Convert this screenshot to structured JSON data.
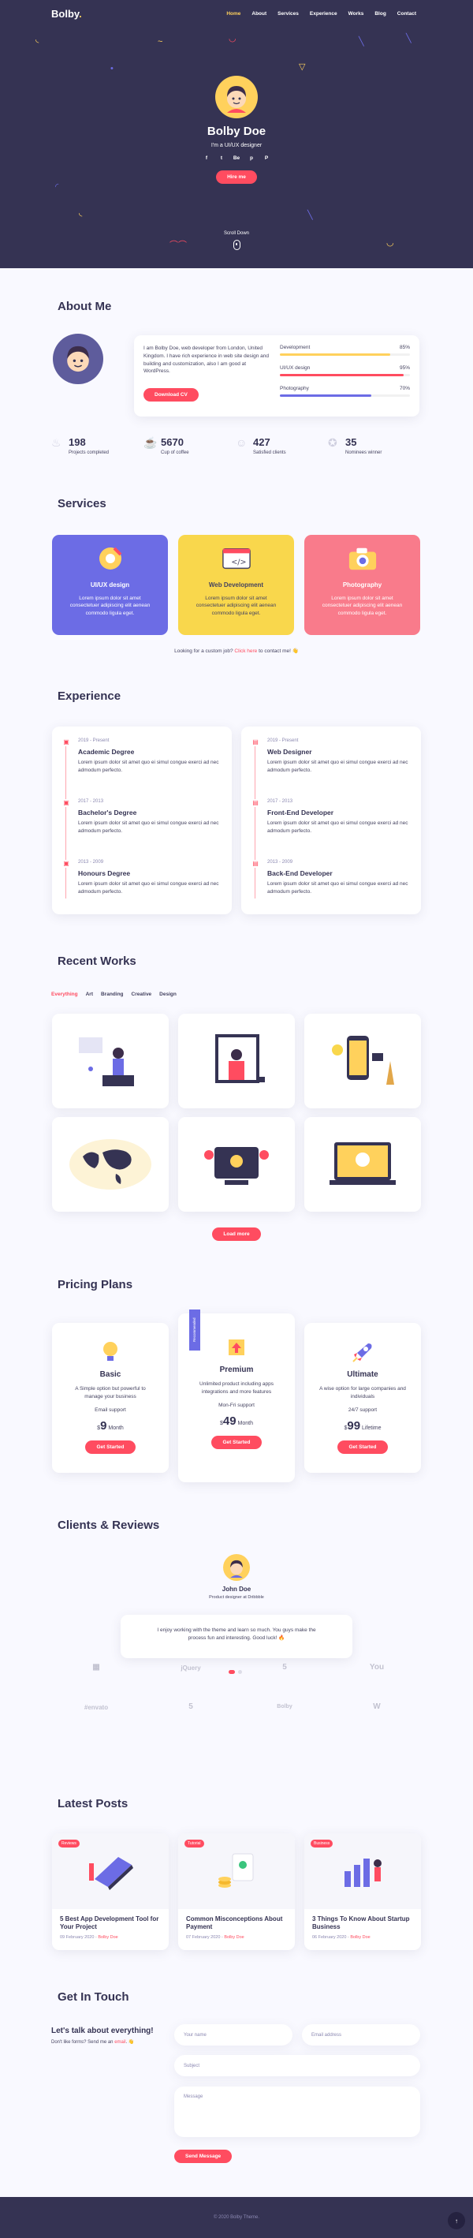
{
  "nav": {
    "logo": "Bolby",
    "logo_dot": ".",
    "items": [
      "Home",
      "About",
      "Services",
      "Experience",
      "Works",
      "Blog",
      "Contact"
    ]
  },
  "hero": {
    "name": "Bolby Doe",
    "subtitle": "I'm a UI/UX designer",
    "socials": [
      "f",
      "t",
      "Be",
      "p",
      "P"
    ],
    "button": "Hire me",
    "scroll": "Scroll Down"
  },
  "about": {
    "title": "About Me",
    "text": "I am Bolby Doe, web developer from London, United Kingdom. I have rich experience in web site design and building and customization, also I am good at WordPress.",
    "button": "Download CV",
    "skills": [
      {
        "name": "Development",
        "value": "85%",
        "level": 85,
        "color": "#ffd15c"
      },
      {
        "name": "UI/UX design",
        "value": "95%",
        "level": 95,
        "color": "#ff4c60"
      },
      {
        "name": "Photography",
        "value": "70%",
        "level": 70,
        "color": "#6c6ce5"
      }
    ],
    "facts": [
      {
        "num": "198",
        "label": "Projects completed"
      },
      {
        "num": "5670",
        "label": "Cup of coffee"
      },
      {
        "num": "427",
        "label": "Satisfied clients"
      },
      {
        "num": "35",
        "label": "Nominees winner"
      }
    ]
  },
  "services": {
    "title": "Services",
    "items": [
      {
        "title": "UI/UX design",
        "text": "Lorem ipsum dolor sit amet consectetuer adipiscing elit aenean commodo ligula eget.",
        "bg": "#6c6ce5",
        "color": "#ffffff"
      },
      {
        "title": "Web Development",
        "text": "Lorem ipsum dolor sit amet consectetuer adipiscing elit aenean commodo ligula eget.",
        "bg": "#f9d74c",
        "color": "#454360"
      },
      {
        "title": "Photography",
        "text": "Lorem ipsum dolor sit amet consectetuer adipiscing elit aenean commodo ligula eget.",
        "bg": "#f97b8b",
        "color": "#ffffff"
      }
    ],
    "note_pre": "Looking for a custom job?",
    "note_link": "Click here",
    "note_post": "to contact me! 👋"
  },
  "experience": {
    "title": "Experience",
    "education": [
      {
        "date": "2019 - Present",
        "title": "Academic Degree",
        "text": "Lorem ipsum dolor sit amet quo ei simul congue exerci ad nec admodum perfecto."
      },
      {
        "date": "2017 - 2013",
        "title": "Bachelor's Degree",
        "text": "Lorem ipsum dolor sit amet quo ei simul congue exerci ad nec admodum perfecto."
      },
      {
        "date": "2013 - 2009",
        "title": "Honours Degree",
        "text": "Lorem ipsum dolor sit amet quo ei simul congue exerci ad nec admodum perfecto."
      }
    ],
    "work": [
      {
        "date": "2019 - Present",
        "title": "Web Designer",
        "text": "Lorem ipsum dolor sit amet quo ei simul congue exerci ad nec admodum perfecto."
      },
      {
        "date": "2017 - 2013",
        "title": "Front-End Developer",
        "text": "Lorem ipsum dolor sit amet quo ei simul congue exerci ad nec admodum perfecto."
      },
      {
        "date": "2013 - 2009",
        "title": "Back-End Developer",
        "text": "Lorem ipsum dolor sit amet quo ei simul congue exerci ad nec admodum perfecto."
      }
    ]
  },
  "works": {
    "title": "Recent Works",
    "filters": [
      "Everything",
      "Art",
      "Branding",
      "Creative",
      "Design"
    ],
    "load_more": "Load more"
  },
  "pricing": {
    "title": "Pricing Plans",
    "plans": [
      {
        "name": "Basic",
        "text": "A Simple option but powerful to manage your business",
        "support": "Email support",
        "currency": "$",
        "price": "9",
        "period": "Month",
        "button": "Get Started"
      },
      {
        "name": "Premium",
        "text": "Unlimited product including apps integrations and more features",
        "support": "Mon-Fri support",
        "currency": "$",
        "price": "49",
        "period": "Month",
        "button": "Get Started",
        "ribbon": "Recommended"
      },
      {
        "name": "Ultimate",
        "text": "A wise option for large companies and individuals",
        "support": "24/7 support",
        "currency": "$",
        "price": "99",
        "period": "Lifetime",
        "button": "Get Started"
      }
    ]
  },
  "clients": {
    "title": "Clients & Reviews",
    "name": "John Doe",
    "role": "Product designer at Dribbble",
    "quote": "I enjoy working with the theme and learn so much. You guys make the process fun and interesting. Good luck! 🔥",
    "logos": [
      "▦",
      "jQuery",
      "5",
      "You",
      "#envato",
      "5",
      "Bolby",
      "W"
    ]
  },
  "posts": {
    "title": "Latest Posts",
    "items": [
      {
        "tag": "Reviews",
        "title": "5 Best App Development Tool for Your Project",
        "date": "09 February 2020",
        "author": "Bolby Doe"
      },
      {
        "tag": "Tutorial",
        "title": "Common Misconceptions About Payment",
        "date": "07 February 2020",
        "author": "Bolby Doe"
      },
      {
        "tag": "Business",
        "title": "3 Things To Know About Startup Business",
        "date": "06 February 2020",
        "author": "Bolby Doe"
      }
    ]
  },
  "contact": {
    "title": "Get In Touch",
    "heading": "Let's talk about everything!",
    "text_pre": "Don't like forms? Send me an",
    "text_link": "email",
    "text_post": ". 👋",
    "name_ph": "Your name",
    "email_ph": "Email address",
    "subject_ph": "Subject",
    "message_ph": "Message",
    "button": "Send Message"
  },
  "footer": {
    "text": "© 2020 Bolby Theme.",
    "top": "↑"
  }
}
